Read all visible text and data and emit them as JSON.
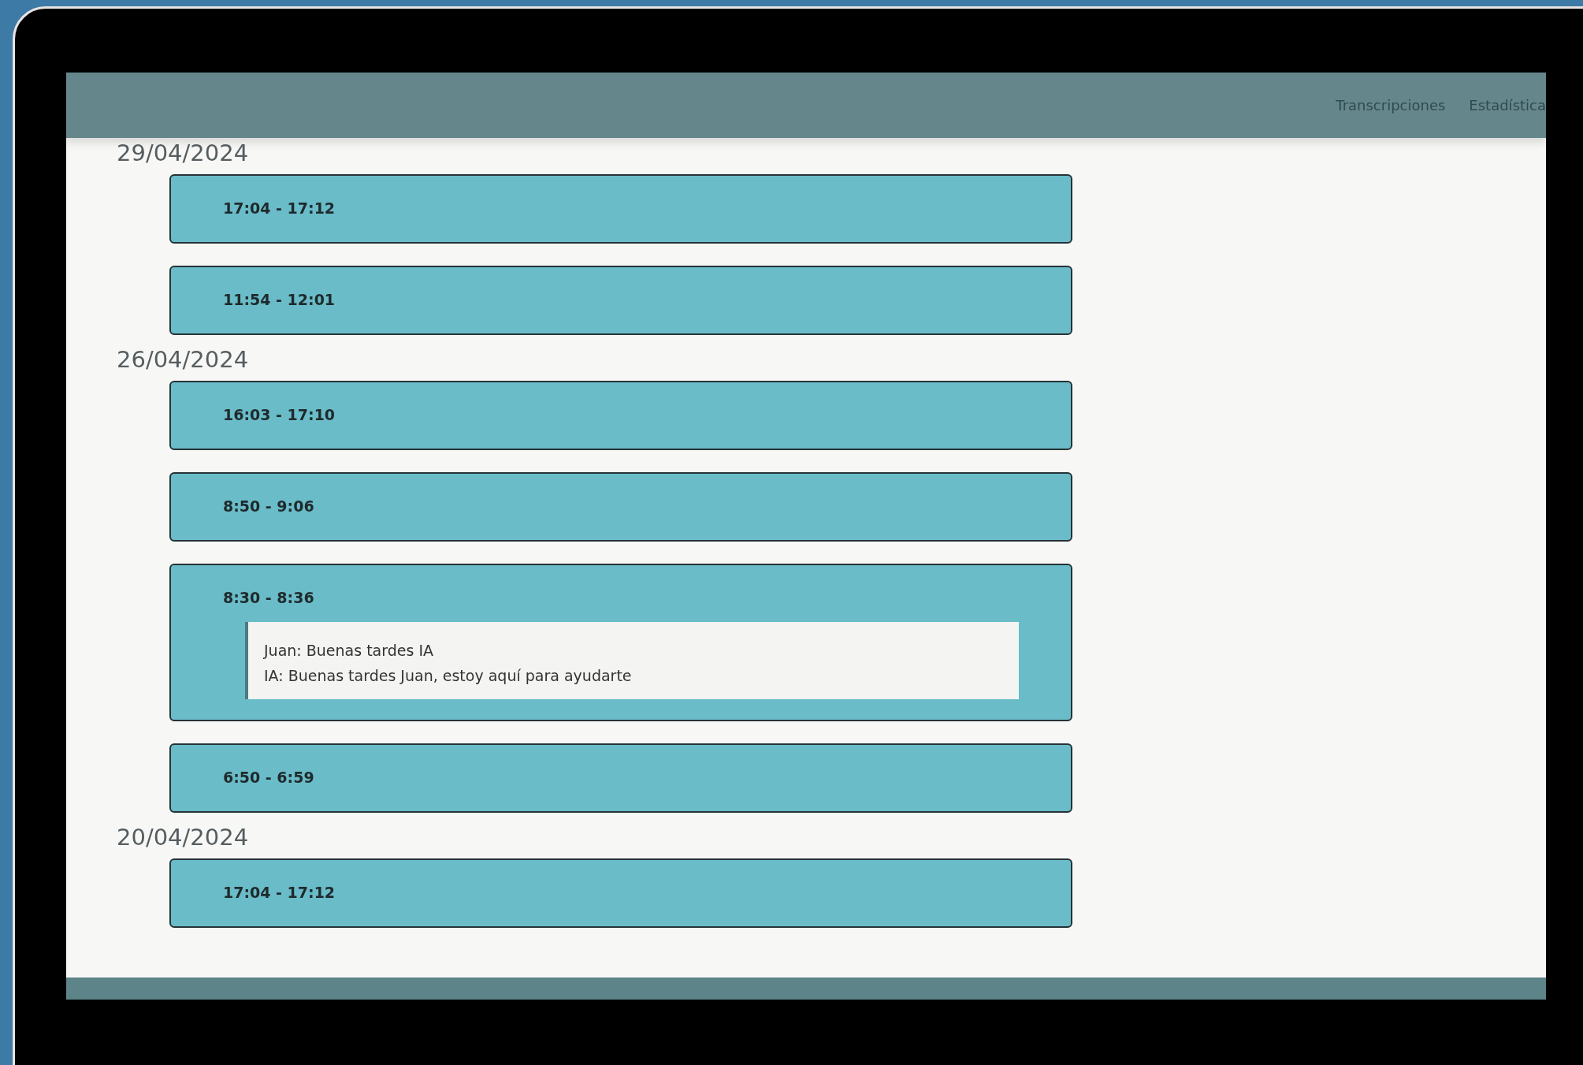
{
  "header": {
    "nav_links": [
      {
        "label": "Transcripciones"
      },
      {
        "label": "Estadística"
      }
    ]
  },
  "groups": [
    {
      "date": "29/04/2024",
      "sessions": [
        {
          "time": "17:04 - 17:12",
          "expanded": false
        },
        {
          "time": "11:54 - 12:01",
          "expanded": false
        }
      ]
    },
    {
      "date": "26/04/2024",
      "sessions": [
        {
          "time": "16:03 - 17:10",
          "expanded": false
        },
        {
          "time": "8:50 - 9:06",
          "expanded": false
        },
        {
          "time": "8:30 - 8:36",
          "expanded": true,
          "messages": [
            "Juan: Buenas tardes IA",
            "IA: Buenas tardes Juan, estoy aquí para ayudarte"
          ]
        },
        {
          "time": "6:50 - 6:59",
          "expanded": false
        }
      ]
    },
    {
      "date": "20/04/2024",
      "sessions": [
        {
          "time": "17:04 - 17:12",
          "expanded": false
        }
      ]
    }
  ]
}
